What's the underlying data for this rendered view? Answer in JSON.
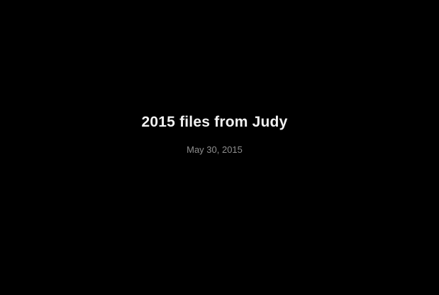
{
  "slide": {
    "title": "2015 files from Judy",
    "date": "May 30, 2015"
  },
  "colors": {
    "background": "#000000",
    "title": "#f2f2f2",
    "date": "#8e8e8e"
  }
}
